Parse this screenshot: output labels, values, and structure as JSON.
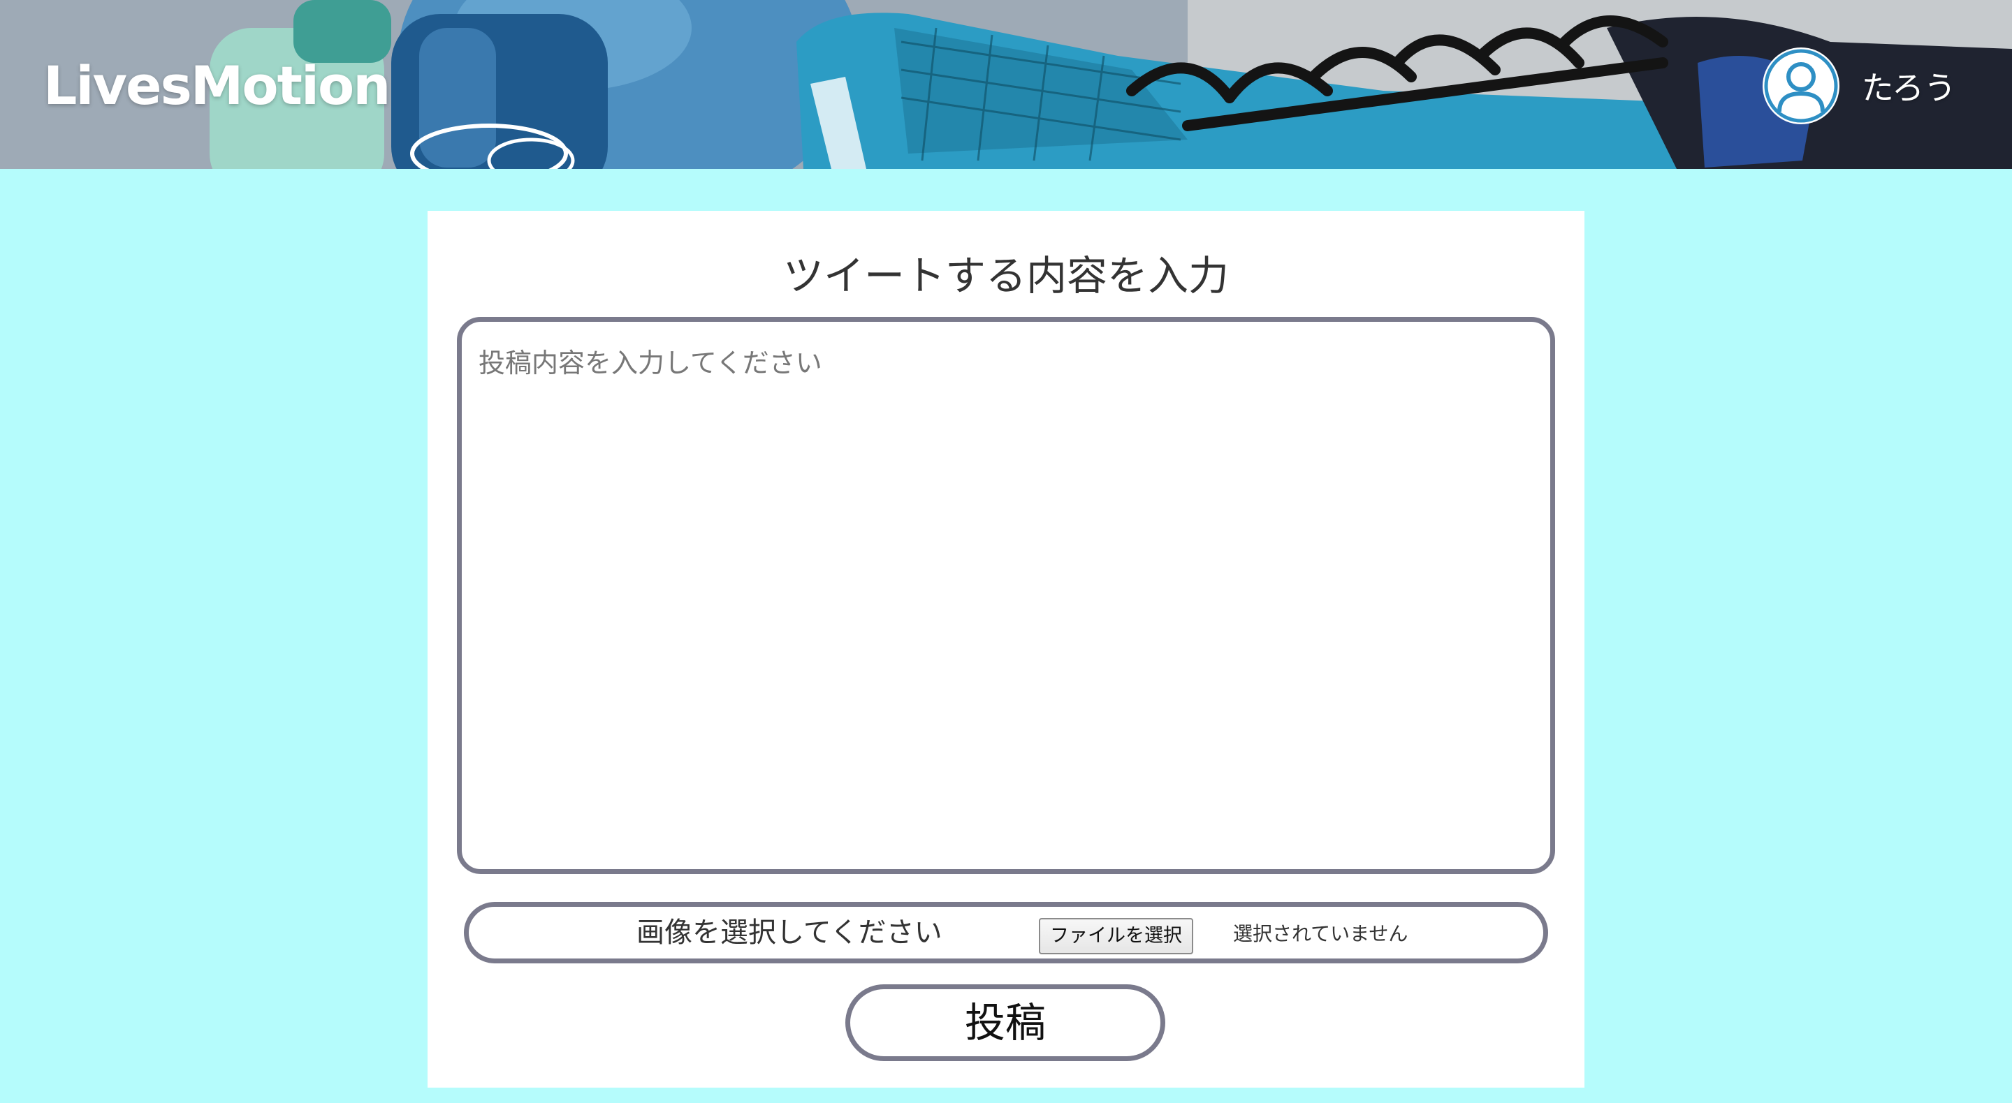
{
  "header": {
    "logo": "LivesMotion",
    "username": "たろう"
  },
  "form": {
    "title": "ツイートする内容を入力",
    "textarea_placeholder": "投稿内容を入力してください",
    "image_label": "画像を選択してください",
    "file_button_label": "ファイルを選択",
    "file_status": "選択されていません",
    "submit_label": "投稿"
  },
  "colors": {
    "page_background": "#b5fcfc",
    "card_background": "#ffffff",
    "border": "#7a7a8c",
    "avatar_accent": "#2e8fc4"
  },
  "icons": {
    "avatar": "user-avatar-icon",
    "header_photo": "fitness-shoe-dumbbell-photo"
  }
}
